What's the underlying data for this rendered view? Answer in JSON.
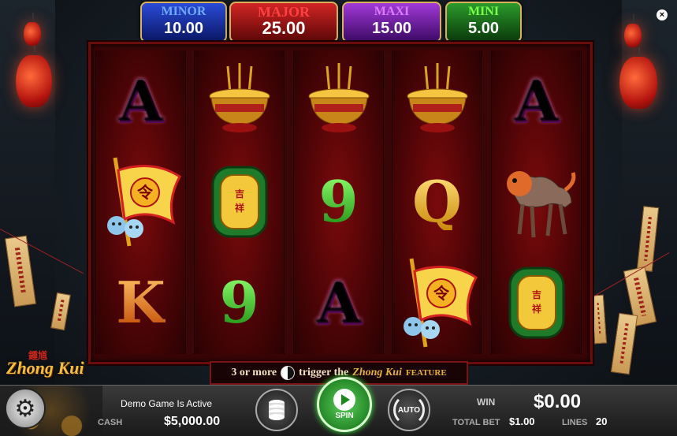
{
  "jackpots": {
    "minor": {
      "label": "MINOR",
      "value": "10.00"
    },
    "major": {
      "label": "MAJOR",
      "value": "25.00"
    },
    "maxi": {
      "label": "MAXI",
      "value": "15.00"
    },
    "mini": {
      "label": "MINI",
      "value": "5.00"
    }
  },
  "close_label": "×",
  "reels": [
    [
      "A",
      "flag",
      "K"
    ],
    [
      "pot",
      "jade",
      "9"
    ],
    [
      "pot",
      "9",
      "A"
    ],
    [
      "pot",
      "Q",
      "flag"
    ],
    [
      "A",
      "lion",
      "jade"
    ]
  ],
  "symbols": {
    "flag": {
      "glyph": "令"
    },
    "jade": {
      "glyph": "吉祥"
    }
  },
  "logo": {
    "chinese": "鍾馗",
    "english": "Zhong Kui"
  },
  "banner": {
    "prefix": "3 or more",
    "middle": "trigger the",
    "game": "Zhong Kui",
    "feature": "FEATURE"
  },
  "controls": {
    "demo_status": "Demo Game Is Active",
    "cash_label": "CASH",
    "cash_value": "$5,000.00",
    "spin_label": "SPIN",
    "auto_label": "AUTO",
    "settings_icon": "⚙",
    "win_label": "WIN",
    "win_value": "$0.00",
    "total_bet_label": "TOTAL BET",
    "total_bet_value": "$1.00",
    "lines_label": "LINES",
    "lines_value": "20"
  },
  "colors": {
    "minor": "#2a4bd6",
    "major": "#d22525",
    "maxi": "#a13ad8",
    "mini": "#2b9a2b",
    "spin": "#2fa52f"
  }
}
